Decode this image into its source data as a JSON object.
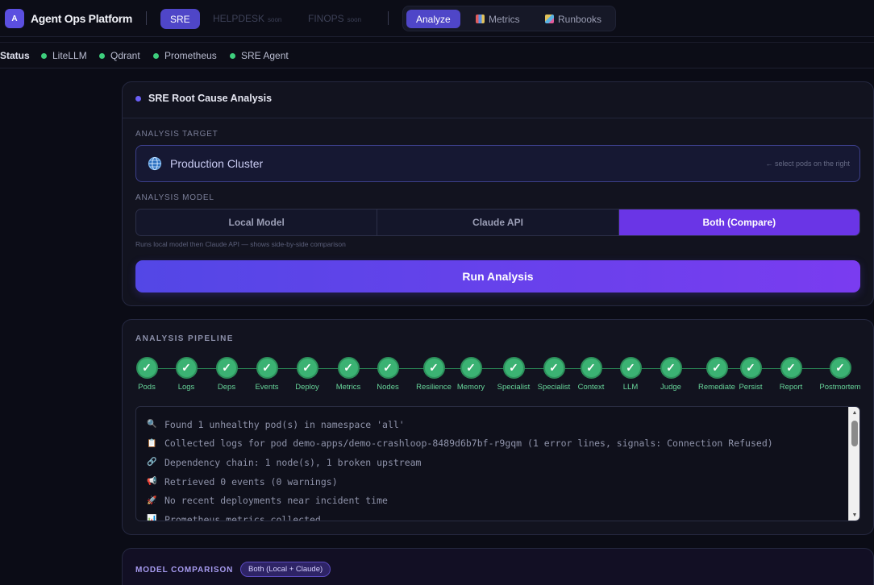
{
  "header": {
    "logo_letter": "A",
    "app_title": "Agent Ops Platform",
    "domains": [
      {
        "label": "SRE",
        "soon": ""
      },
      {
        "label": "HELPDESK",
        "soon": "soon"
      },
      {
        "label": "FINOPS",
        "soon": "soon"
      }
    ],
    "nav_tabs": [
      {
        "label": "Analyze",
        "icon": ""
      },
      {
        "label": "Metrics",
        "icon": "bar-chart-icon"
      },
      {
        "label": "Runbooks",
        "icon": "book-icon"
      }
    ]
  },
  "status": {
    "label": "Status",
    "items": [
      "LiteLLM",
      "Qdrant",
      "Prometheus",
      "SRE Agent"
    ],
    "ok_color": "#3ecf7d"
  },
  "analysis": {
    "title": "SRE Root Cause Analysis",
    "target_label": "ANALYSIS TARGET",
    "target_value": "Production Cluster",
    "target_hint": "← select pods on the right",
    "model_label": "ANALYSIS MODEL",
    "models": [
      "Local Model",
      "Claude API",
      "Both (Compare)"
    ],
    "selected_model": "Both (Compare)",
    "model_hint": "Runs local model then Claude API — shows side-by-side comparison",
    "run_button": "Run Analysis"
  },
  "pipeline": {
    "label": "ANALYSIS PIPELINE",
    "stages": [
      "Pods",
      "Logs",
      "Deps",
      "Events",
      "Deploy",
      "Metrics",
      "Nodes",
      "Resilience",
      "Memory",
      "Specialist",
      "Specialist",
      "Context",
      "LLM",
      "Judge",
      "Remediate",
      "Persist",
      "Report",
      "Postmortem"
    ],
    "check_glyph": "✓",
    "logs": [
      {
        "icon": "🔍",
        "text": "Found 1 unhealthy pod(s) in namespace 'all'"
      },
      {
        "icon": "📋",
        "text": "Collected logs for pod demo-apps/demo-crashloop-8489d6b7bf-r9gqm (1 error lines, signals: Connection Refused)"
      },
      {
        "icon": "🔗",
        "text": "Dependency chain: 1 node(s), 1 broken upstream"
      },
      {
        "icon": "📢",
        "text": "Retrieved 0 events (0 warnings)"
      },
      {
        "icon": "🚀",
        "text": "No recent deployments near incident time"
      },
      {
        "icon": "📊",
        "text": "Prometheus metrics collected."
      }
    ]
  },
  "comparison": {
    "label": "MODEL COMPARISON",
    "badge": "Both (Local + Claude)"
  }
}
